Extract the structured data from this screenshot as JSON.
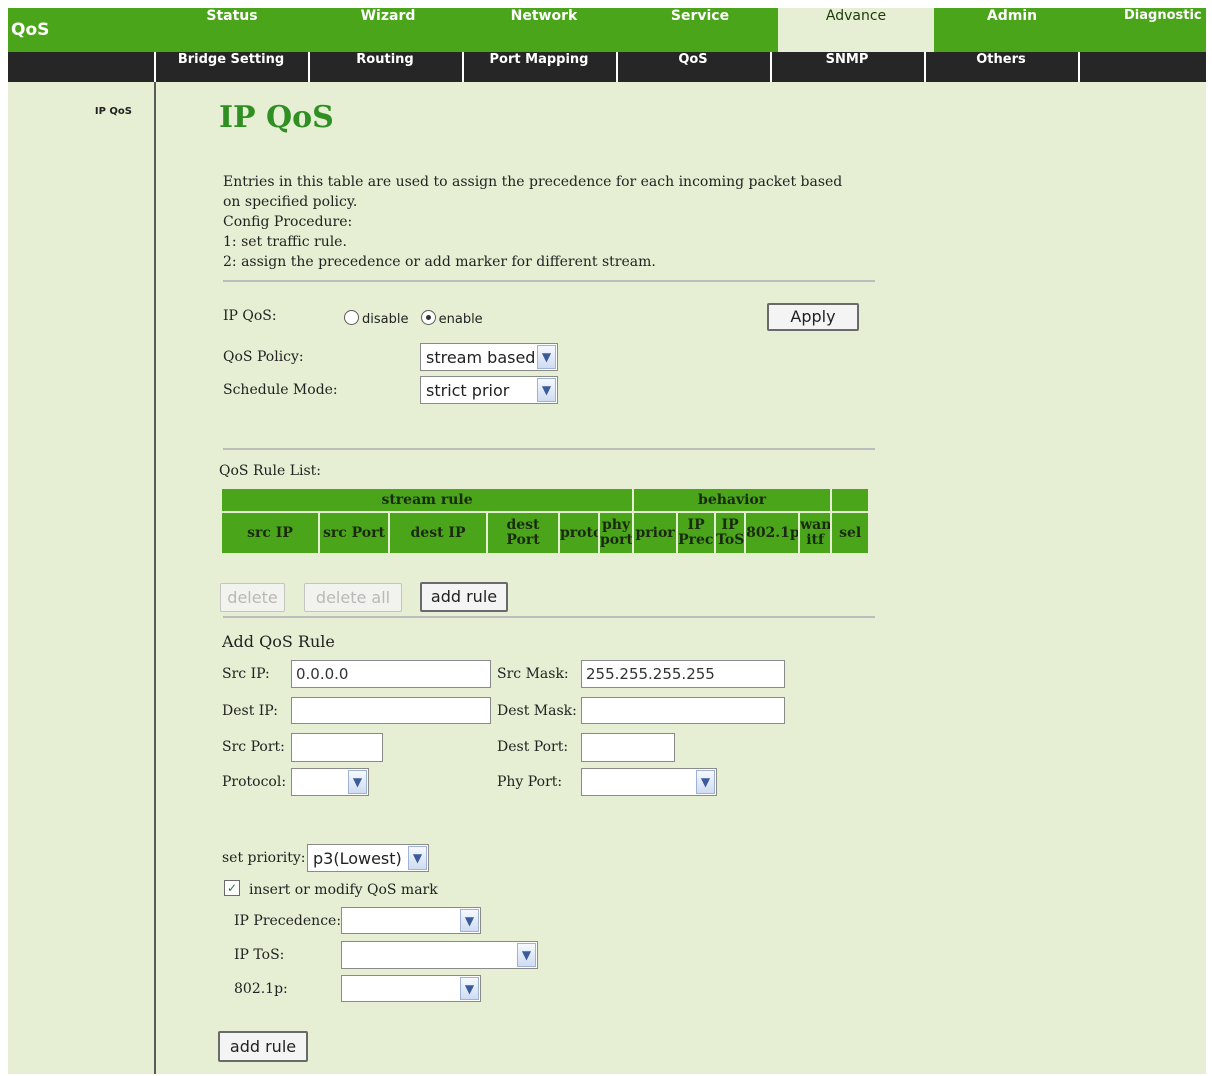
{
  "app": {
    "logo": "QoS"
  },
  "top_tabs": [
    {
      "label": "Status",
      "active": false
    },
    {
      "label": "Wizard",
      "active": false
    },
    {
      "label": "Network",
      "active": false
    },
    {
      "label": "Service",
      "active": false
    },
    {
      "label": "Advance",
      "active": true
    },
    {
      "label": "Admin",
      "active": false
    },
    {
      "label": "Diagnostic",
      "active": false
    }
  ],
  "sub_tabs": [
    "Bridge Setting",
    "Routing",
    "Port Mapping",
    "QoS",
    "SNMP",
    "Others"
  ],
  "sidebar": {
    "items": [
      "IP QoS"
    ]
  },
  "page": {
    "title": "IP QoS",
    "description": [
      "Entries in this table are used to assign the precedence for each incoming packet based on specified policy.",
      "Config Procedure:",
      "1: set traffic rule.",
      "2: assign the precedence or add marker for different stream."
    ]
  },
  "settings": {
    "ipqos_label": "IP QoS:",
    "ipqos_options": [
      "disable",
      "enable"
    ],
    "ipqos_selected": "enable",
    "apply_label": "Apply",
    "policy_label": "QoS Policy:",
    "policy_value": "stream based",
    "schedule_label": "Schedule Mode:",
    "schedule_value": "strict prior"
  },
  "rule_list": {
    "title": "QoS Rule List:",
    "group_headers": [
      "stream rule",
      "behavior"
    ],
    "columns": [
      "src IP",
      "src Port",
      "dest IP",
      "dest Port",
      "proto",
      "phy port",
      "prior",
      "IP Precd",
      "IP ToS",
      "802.1p",
      "wan itf",
      "sel"
    ],
    "rows": []
  },
  "list_buttons": {
    "delete": "delete",
    "delete_all": "delete all",
    "add_rule": "add rule"
  },
  "add_rule": {
    "title": "Add QoS Rule",
    "src_ip_label": "Src IP:",
    "src_ip_value": "0.0.0.0",
    "src_mask_label": "Src Mask:",
    "src_mask_value": "255.255.255.255",
    "dest_ip_label": "Dest IP:",
    "dest_ip_value": "",
    "dest_mask_label": "Dest Mask:",
    "dest_mask_value": "",
    "src_port_label": "Src Port:",
    "src_port_value": "",
    "dest_port_label": "Dest Port:",
    "dest_port_value": "",
    "protocol_label": "Protocol:",
    "protocol_value": "",
    "phyport_label": "Phy Port:",
    "phyport_value": "",
    "priority_label": "set priority:",
    "priority_value": "p3(Lowest)",
    "mark_label": "insert or modify QoS mark",
    "mark_checked": true,
    "ip_precedence_label": "IP Precedence:",
    "ip_precedence_value": "",
    "ip_tos_label": "IP ToS:",
    "ip_tos_value": "",
    "dot1p_label": "802.1p:",
    "dot1p_value": "",
    "submit_label": "add rule"
  },
  "colors": {
    "brand_green": "#4ba51a",
    "page_bg": "#e6efd3",
    "subbar": "#262626",
    "title_green": "#2f8f22"
  },
  "icons": {
    "dropdown": "chevron-down-icon",
    "checkbox": "checkmark-icon"
  }
}
